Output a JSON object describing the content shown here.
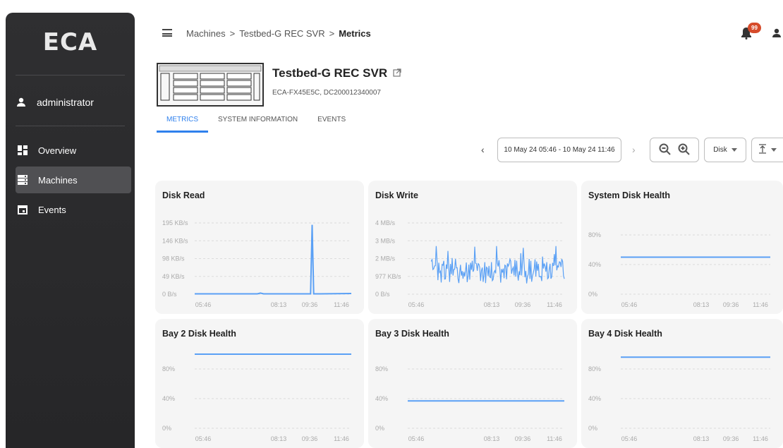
{
  "sidebar": {
    "logo": "ECA",
    "user": "administrator",
    "items": [
      {
        "label": "Overview",
        "icon": "dashboard-icon"
      },
      {
        "label": "Machines",
        "icon": "server-icon",
        "active": true
      },
      {
        "label": "Events",
        "icon": "calendar-icon"
      }
    ]
  },
  "header": {
    "breadcrumb": [
      "Machines",
      "Testbed-G REC SVR",
      "Metrics"
    ],
    "separator": ">",
    "notification_count": "99"
  },
  "machine": {
    "name": "Testbed-G REC SVR",
    "subtitle": "ECA-FX45E5C, DC200012340007"
  },
  "tabs": [
    "METRICS",
    "SYSTEM INFORMATION",
    "EVENTS"
  ],
  "toolbar": {
    "range": "10 May 24 05:46 - 10 May 24 11:46",
    "prev": "‹",
    "next": "›",
    "category": "Disk"
  },
  "colors": {
    "accent": "#2f80ed",
    "series": "#5aa0f5",
    "badge": "#d64b2b",
    "sidebar": "#2b2b2d"
  },
  "chart_data": [
    {
      "type": "line",
      "title": "Disk Read",
      "yticks": [
        "0 B/s",
        "49 KB/s",
        "98 KB/s",
        "146 KB/s",
        "195 KB/s"
      ],
      "ylim": [
        0,
        195
      ],
      "xticks": [
        "05:46",
        "08:13",
        "09:36",
        "11:46"
      ],
      "series": [
        {
          "points": [
            [
              0,
              1
            ],
            [
              0.3,
              1
            ],
            [
              0.4,
              1
            ],
            [
              0.42,
              3
            ],
            [
              0.44,
              1
            ],
            [
              0.74,
              1
            ],
            [
              0.75,
              190
            ],
            [
              0.76,
              1
            ],
            [
              0.8,
              1
            ],
            [
              1,
              2
            ]
          ]
        }
      ]
    },
    {
      "type": "line",
      "title": "Disk Write",
      "yticks": [
        "0 B/s",
        "977 KB/s",
        "2 MB/s",
        "3 MB/s",
        "4 MB/s"
      ],
      "ylim": [
        0,
        4
      ],
      "xticks": [
        "05:46",
        "08:13",
        "09:36",
        "11:46"
      ],
      "series": [
        {
          "noisy": true,
          "range": [
            0.1,
            2.2
          ],
          "start": 0.15,
          "end": 1
        }
      ]
    },
    {
      "type": "line",
      "title": "System Disk Health",
      "yticks": [
        "0%",
        "40%",
        "80%"
      ],
      "ylim": [
        0,
        100
      ],
      "xticks": [
        "05:46",
        "08:13",
        "09:36",
        "11:46"
      ],
      "series": [
        {
          "points": [
            [
              0,
              50
            ],
            [
              1,
              50
            ]
          ]
        }
      ]
    },
    {
      "type": "line",
      "title": "Bay 2 Disk Health",
      "yticks": [
        "0%",
        "40%",
        "80%"
      ],
      "ylim": [
        0,
        100
      ],
      "xticks": [
        "05:46",
        "08:13",
        "09:36",
        "11:46"
      ],
      "series": [
        {
          "points": [
            [
              0,
              100
            ],
            [
              1,
              100
            ]
          ]
        }
      ]
    },
    {
      "type": "line",
      "title": "Bay 3 Disk Health",
      "yticks": [
        "0%",
        "40%",
        "80%"
      ],
      "ylim": [
        0,
        100
      ],
      "xticks": [
        "05:46",
        "08:13",
        "09:36",
        "11:46"
      ],
      "series": [
        {
          "points": [
            [
              0,
              37
            ],
            [
              1,
              37
            ]
          ]
        }
      ]
    },
    {
      "type": "line",
      "title": "Bay 4 Disk Health",
      "yticks": [
        "0%",
        "40%",
        "80%"
      ],
      "ylim": [
        0,
        100
      ],
      "xticks": [
        "05:46",
        "08:13",
        "09:36",
        "11:46"
      ],
      "series": [
        {
          "points": [
            [
              0,
              96
            ],
            [
              1,
              96
            ]
          ]
        }
      ]
    }
  ]
}
